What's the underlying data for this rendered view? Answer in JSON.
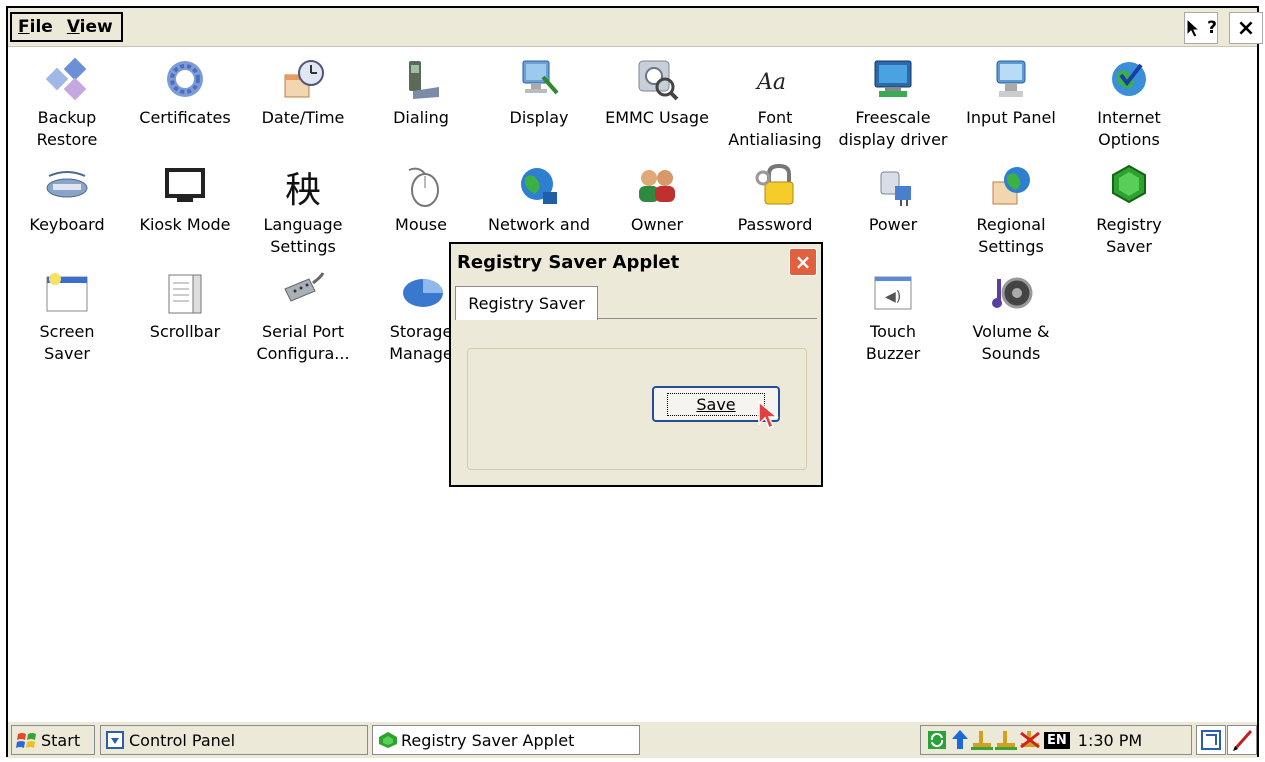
{
  "menubar": {
    "file": "File",
    "file_ul": "F",
    "file_rest": "ile",
    "view": "View",
    "view_ul": "V",
    "view_rest": "iew"
  },
  "topbar": {
    "help": "?",
    "close": "×"
  },
  "icons": [
    {
      "label": "Backup\nRestore",
      "icon": "backup-restore-icon"
    },
    {
      "label": "Certificates",
      "icon": "certificates-icon"
    },
    {
      "label": "Date/Time",
      "icon": "date-time-icon"
    },
    {
      "label": "Dialing",
      "icon": "dialing-icon"
    },
    {
      "label": "Display",
      "icon": "display-icon"
    },
    {
      "label": "EMMC Usage",
      "icon": "emmc-usage-icon"
    },
    {
      "label": "Font\nAntialiasing",
      "icon": "font-icon"
    },
    {
      "label": "Freescale\ndisplay driver",
      "icon": "freescale-display-icon"
    },
    {
      "label": "Input Panel",
      "icon": "input-panel-icon"
    },
    {
      "label": "Internet\nOptions",
      "icon": "internet-options-icon"
    },
    {
      "label": "Keyboard",
      "icon": "keyboard-icon"
    },
    {
      "label": "Kiosk Mode",
      "icon": "kiosk-mode-icon"
    },
    {
      "label": "Language\nSettings",
      "icon": "language-icon"
    },
    {
      "label": "Mouse",
      "icon": "mouse-icon"
    },
    {
      "label": "Network and",
      "icon": "network-icon"
    },
    {
      "label": "Owner",
      "icon": "owner-icon"
    },
    {
      "label": "Password",
      "icon": "password-icon"
    },
    {
      "label": "Power",
      "icon": "power-icon"
    },
    {
      "label": "Regional\nSettings",
      "icon": "regional-settings-icon"
    },
    {
      "label": "Registry\nSaver",
      "icon": "registry-saver-icon"
    },
    {
      "label": "Screen\nSaver",
      "icon": "screen-saver-icon"
    },
    {
      "label": "Scrollbar",
      "icon": "scrollbar-icon"
    },
    {
      "label": "Serial Port\nConfigura...",
      "icon": "serial-port-icon"
    },
    {
      "label": "Storage\nManage",
      "icon": "storage-manager-icon"
    },
    {
      "label": "Touch\nBuzzer",
      "icon": "touch-buzzer-icon"
    },
    {
      "label": "Volume &\nSounds",
      "icon": "volume-sounds-icon"
    }
  ],
  "dialog": {
    "title": "Registry Saver Applet",
    "close": "×",
    "tab": "Registry Saver",
    "save_button": "Save"
  },
  "taskbar": {
    "start": "Start",
    "control_panel": "Control Panel",
    "registry_saver": "Registry Saver Applet",
    "lang": "EN",
    "clock": "1:30 PM"
  },
  "colors": {
    "accent": "#264c9c",
    "dialog_close": "#e0603f",
    "background": "#ece9d8"
  }
}
